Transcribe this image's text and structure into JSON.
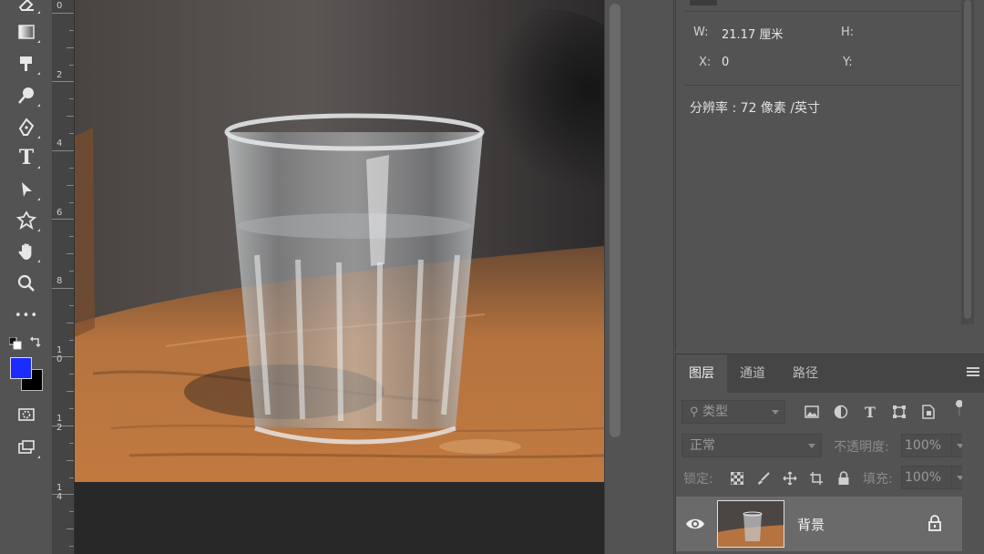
{
  "toolbar": {
    "tools": [
      "eraser-icon",
      "gradient-icon",
      "brush-icon",
      "dodge-icon",
      "pen-icon",
      "type-tool",
      "path-select-icon",
      "custom-shape-icon",
      "hand-icon",
      "zoom-icon",
      "more-icon",
      "quick-mask-icon",
      "screen-mode-icon"
    ],
    "type_tool_glyph": "T",
    "more_glyph": "•••",
    "foreground_color": "#1b2cff",
    "background_color": "#000000"
  },
  "ruler": {
    "labels": [
      "0",
      "2",
      "4",
      "6",
      "8",
      "1\n0",
      "1\n2",
      "1\n4"
    ]
  },
  "properties": {
    "w_label": "W:",
    "w_value": "21.17 厘米",
    "h_label": "H:",
    "x_label": "X:",
    "x_value": "0",
    "y_label": "Y:",
    "resolution": "分辨率 : 72 像素 /英寸"
  },
  "layers_panel": {
    "tabs": [
      "图层",
      "通道",
      "路径"
    ],
    "active_tab": "图层",
    "filter_placeholder": "类型",
    "blend_mode": "正常",
    "opacity_label": "不透明度:",
    "opacity_value": "100%",
    "lock_label": "锁定:",
    "fill_label": "填充:",
    "fill_value": "100%",
    "filter_icons": [
      "image-filter-icon",
      "adjustment-filter-icon",
      "type-filter-icon",
      "shape-filter-icon",
      "smart-object-filter-icon",
      "filter-toggle-icon"
    ],
    "lock_icons": [
      "lock-transparent-icon",
      "lock-paint-icon",
      "lock-position-icon",
      "lock-artboard-icon",
      "lock-all-icon"
    ],
    "layers": [
      {
        "name": "背景",
        "visible": true,
        "locked": true
      }
    ]
  }
}
